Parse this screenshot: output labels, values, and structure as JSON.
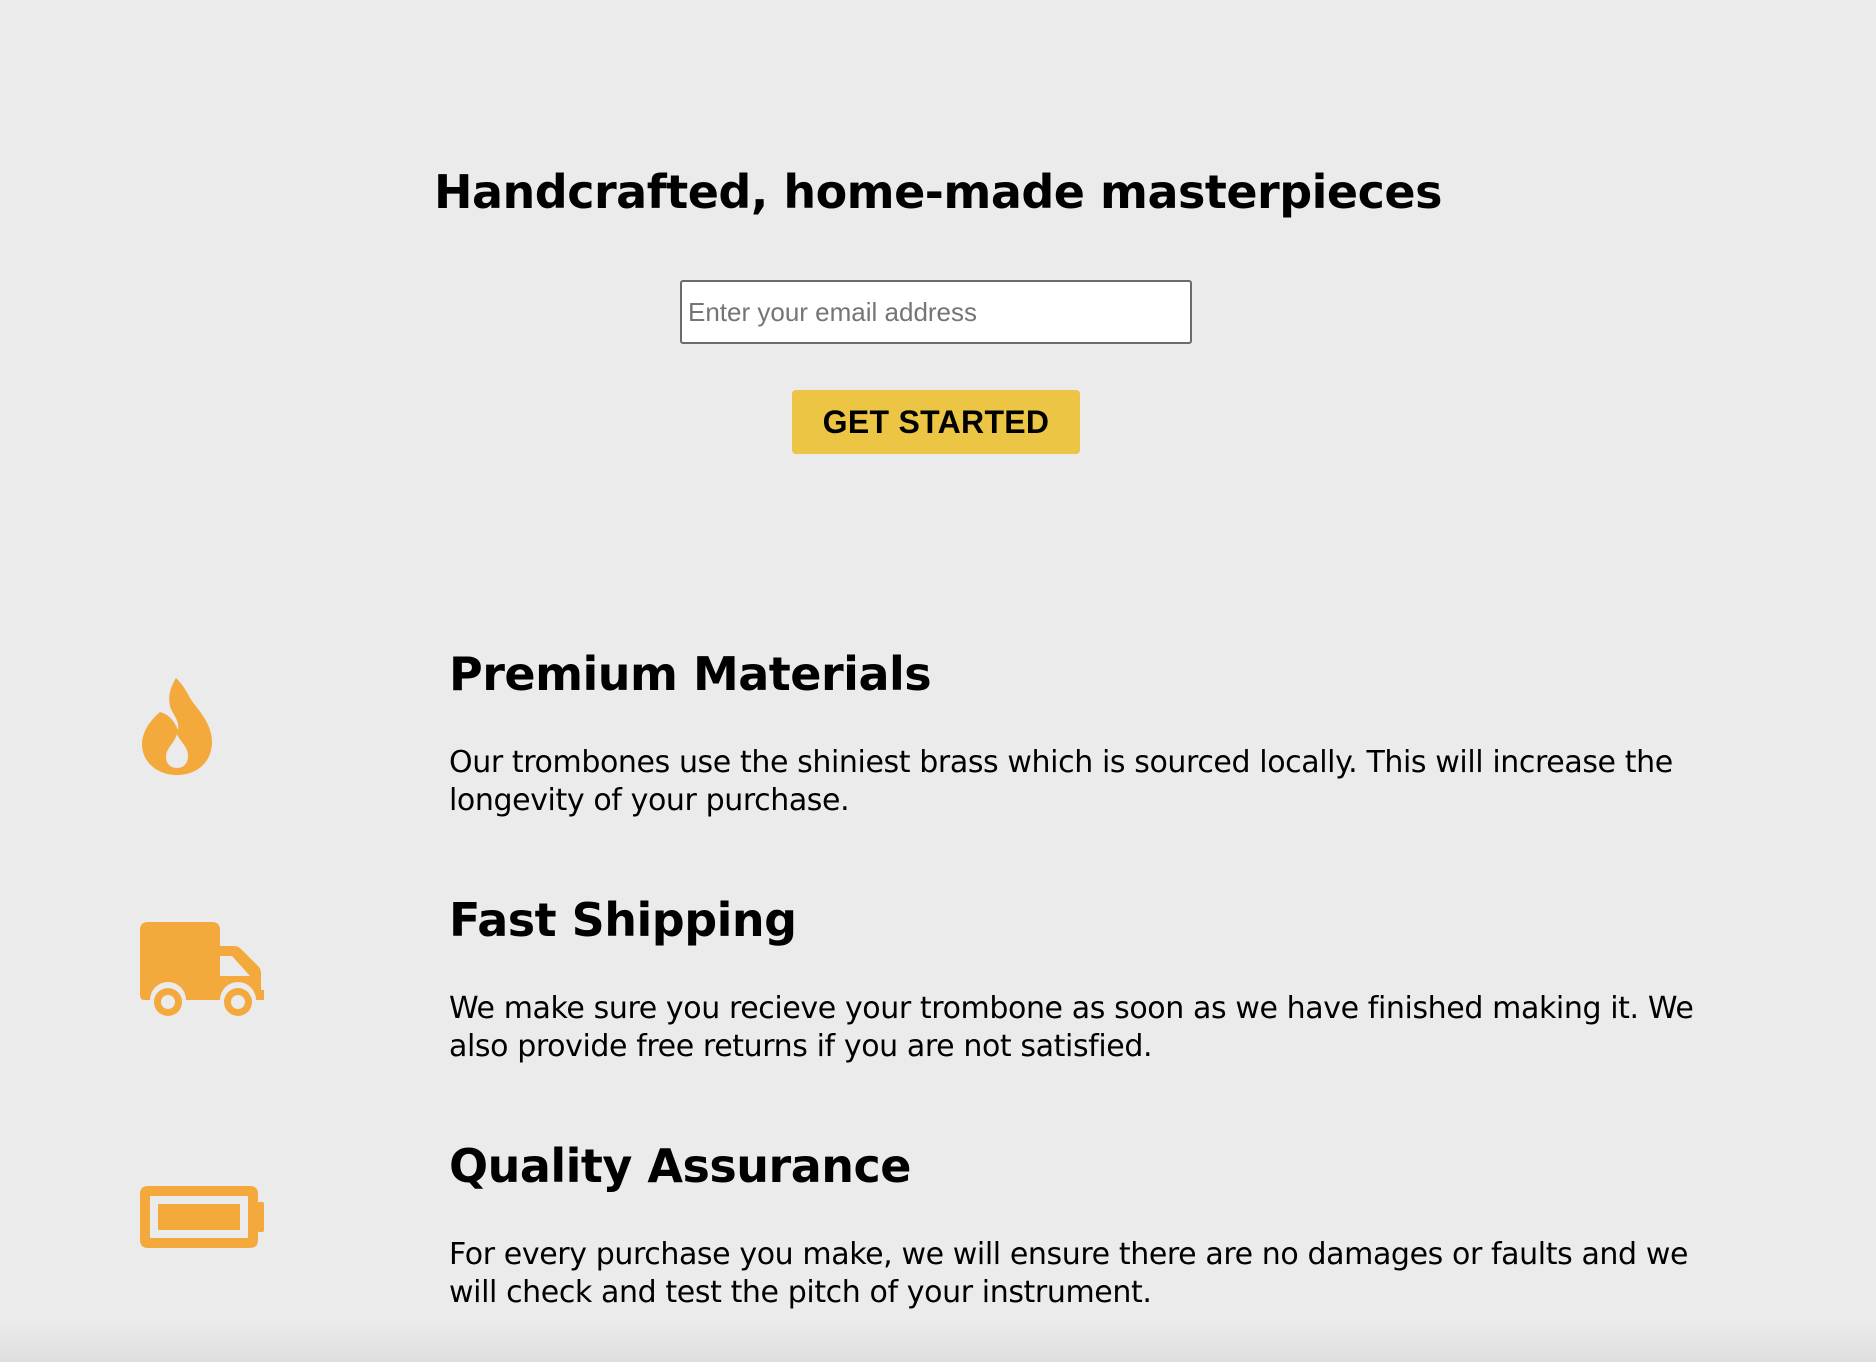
{
  "hero": {
    "title": "Handcrafted, home-made masterpieces",
    "email_placeholder": "Enter your email address",
    "button_label": "GET STARTED"
  },
  "features": [
    {
      "icon": "fire-icon",
      "title": "Premium Materials",
      "text": "Our trombones use the shiniest brass which is sourced locally. This will increase the longevity of your purchase."
    },
    {
      "icon": "truck-icon",
      "title": "Fast Shipping",
      "text": "We make sure you recieve your trombone as soon as we have finished making it. We also provide free returns if you are not satisfied."
    },
    {
      "icon": "battery-full-icon",
      "title": "Quality Assurance",
      "text": "For every purchase you make, we will ensure there are no damages or faults and we will check and test the pitch of your instrument."
    }
  ],
  "colors": {
    "background": "#ebebeb",
    "button": "#ebc543",
    "icon": "#f4a93d"
  }
}
